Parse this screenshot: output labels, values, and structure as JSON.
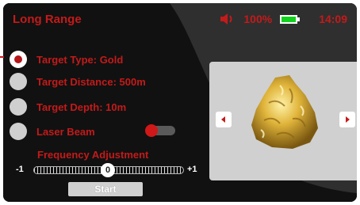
{
  "header": {
    "title": "Long Range",
    "volume": "100%",
    "time": "14:09"
  },
  "options": [
    {
      "label": "Target Type: Gold",
      "selected": true
    },
    {
      "label": "Target Distance: 500m",
      "selected": false
    },
    {
      "label": "Target Depth: 10m",
      "selected": false
    },
    {
      "label": "Laser Beam",
      "selected": false
    }
  ],
  "laser_toggle": {
    "on": false
  },
  "frequency": {
    "title": "Frequency Adjustment",
    "min": "-1",
    "max": "+1",
    "value": "0"
  },
  "start_label": "Start",
  "image_panel": {
    "subject": "gold nugget"
  },
  "battery": {
    "color": "#13d21e"
  },
  "accent_color": "#c41a1a"
}
